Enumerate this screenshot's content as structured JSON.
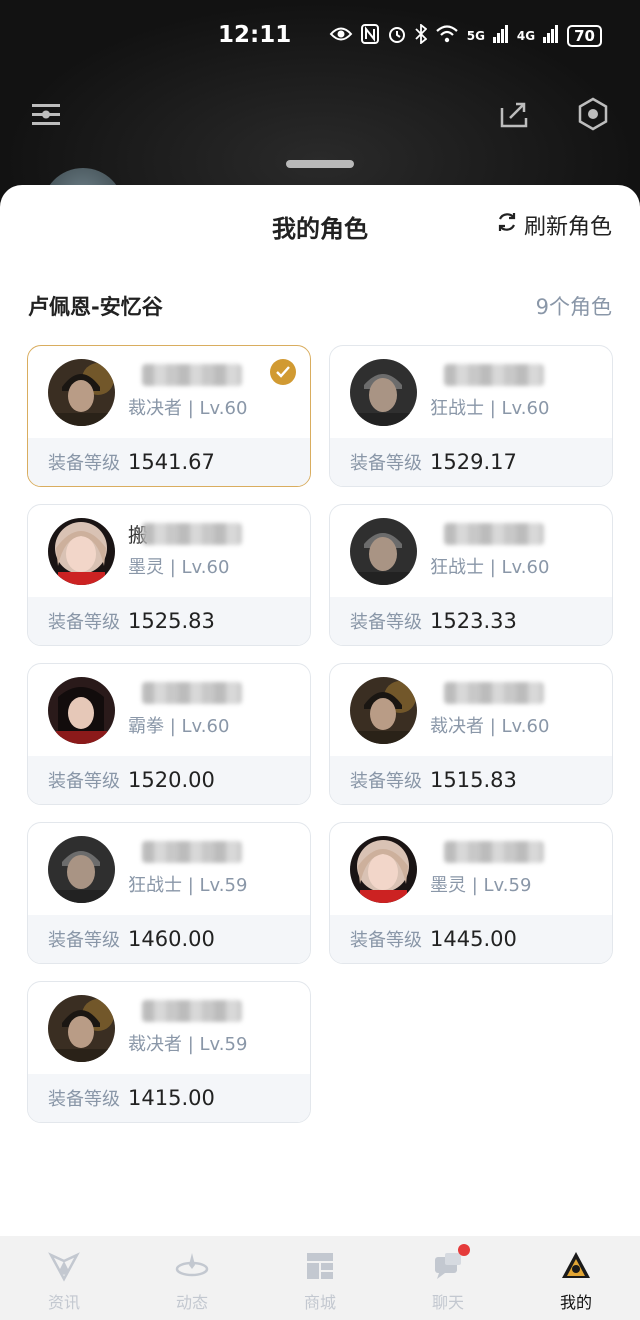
{
  "status_bar": {
    "time": "12:11",
    "network_5g": "5G",
    "network_4g": "4G",
    "battery": "70"
  },
  "sheet": {
    "title": "我的角色",
    "refresh_label": "刷新角色",
    "server": "卢佩恩-安忆谷",
    "role_count": "9个角色",
    "gear_label": "装备等级"
  },
  "characters": [
    {
      "name_prefix": "",
      "class_level": "裁决者 | Lv.60",
      "gear_score": "1541.67",
      "avatar": "male-dark-hair",
      "selected": true
    },
    {
      "name_prefix": "",
      "class_level": "狂战士 | Lv.60",
      "gear_score": "1529.17",
      "avatar": "male-grey-hair",
      "selected": false
    },
    {
      "name_prefix": "搬",
      "class_level": "墨灵 | Lv.60",
      "gear_score": "1525.83",
      "avatar": "female-pink",
      "selected": false
    },
    {
      "name_prefix": "",
      "class_level": "狂战士 | Lv.60",
      "gear_score": "1523.33",
      "avatar": "male-grey-hair",
      "selected": false
    },
    {
      "name_prefix": "",
      "class_level": "霸拳 | Lv.60",
      "gear_score": "1520.00",
      "avatar": "female-dark",
      "selected": false
    },
    {
      "name_prefix": "",
      "class_level": "裁决者 | Lv.60",
      "gear_score": "1515.83",
      "avatar": "male-dark-hair",
      "selected": false
    },
    {
      "name_prefix": "",
      "class_level": "狂战士 | Lv.59",
      "gear_score": "1460.00",
      "avatar": "male-grey-hair",
      "selected": false
    },
    {
      "name_prefix": "",
      "class_level": "墨灵 | Lv.59",
      "gear_score": "1445.00",
      "avatar": "female-pink",
      "selected": false
    },
    {
      "name_prefix": "",
      "class_level": "裁决者 | Lv.59",
      "gear_score": "1415.00",
      "avatar": "male-dark-hair",
      "selected": false
    }
  ],
  "tabs": [
    {
      "label": "资讯",
      "icon": "news-icon",
      "active": false
    },
    {
      "label": "动态",
      "icon": "feed-icon",
      "active": false
    },
    {
      "label": "商城",
      "icon": "store-icon",
      "active": false
    },
    {
      "label": "聊天",
      "icon": "chat-icon",
      "active": false,
      "badge": true
    },
    {
      "label": "我的",
      "icon": "profile-icon",
      "active": true
    }
  ],
  "colors": {
    "accent_gold": "#d19a32",
    "muted_text": "#8a97a8",
    "badge_red": "#e53b3b"
  }
}
